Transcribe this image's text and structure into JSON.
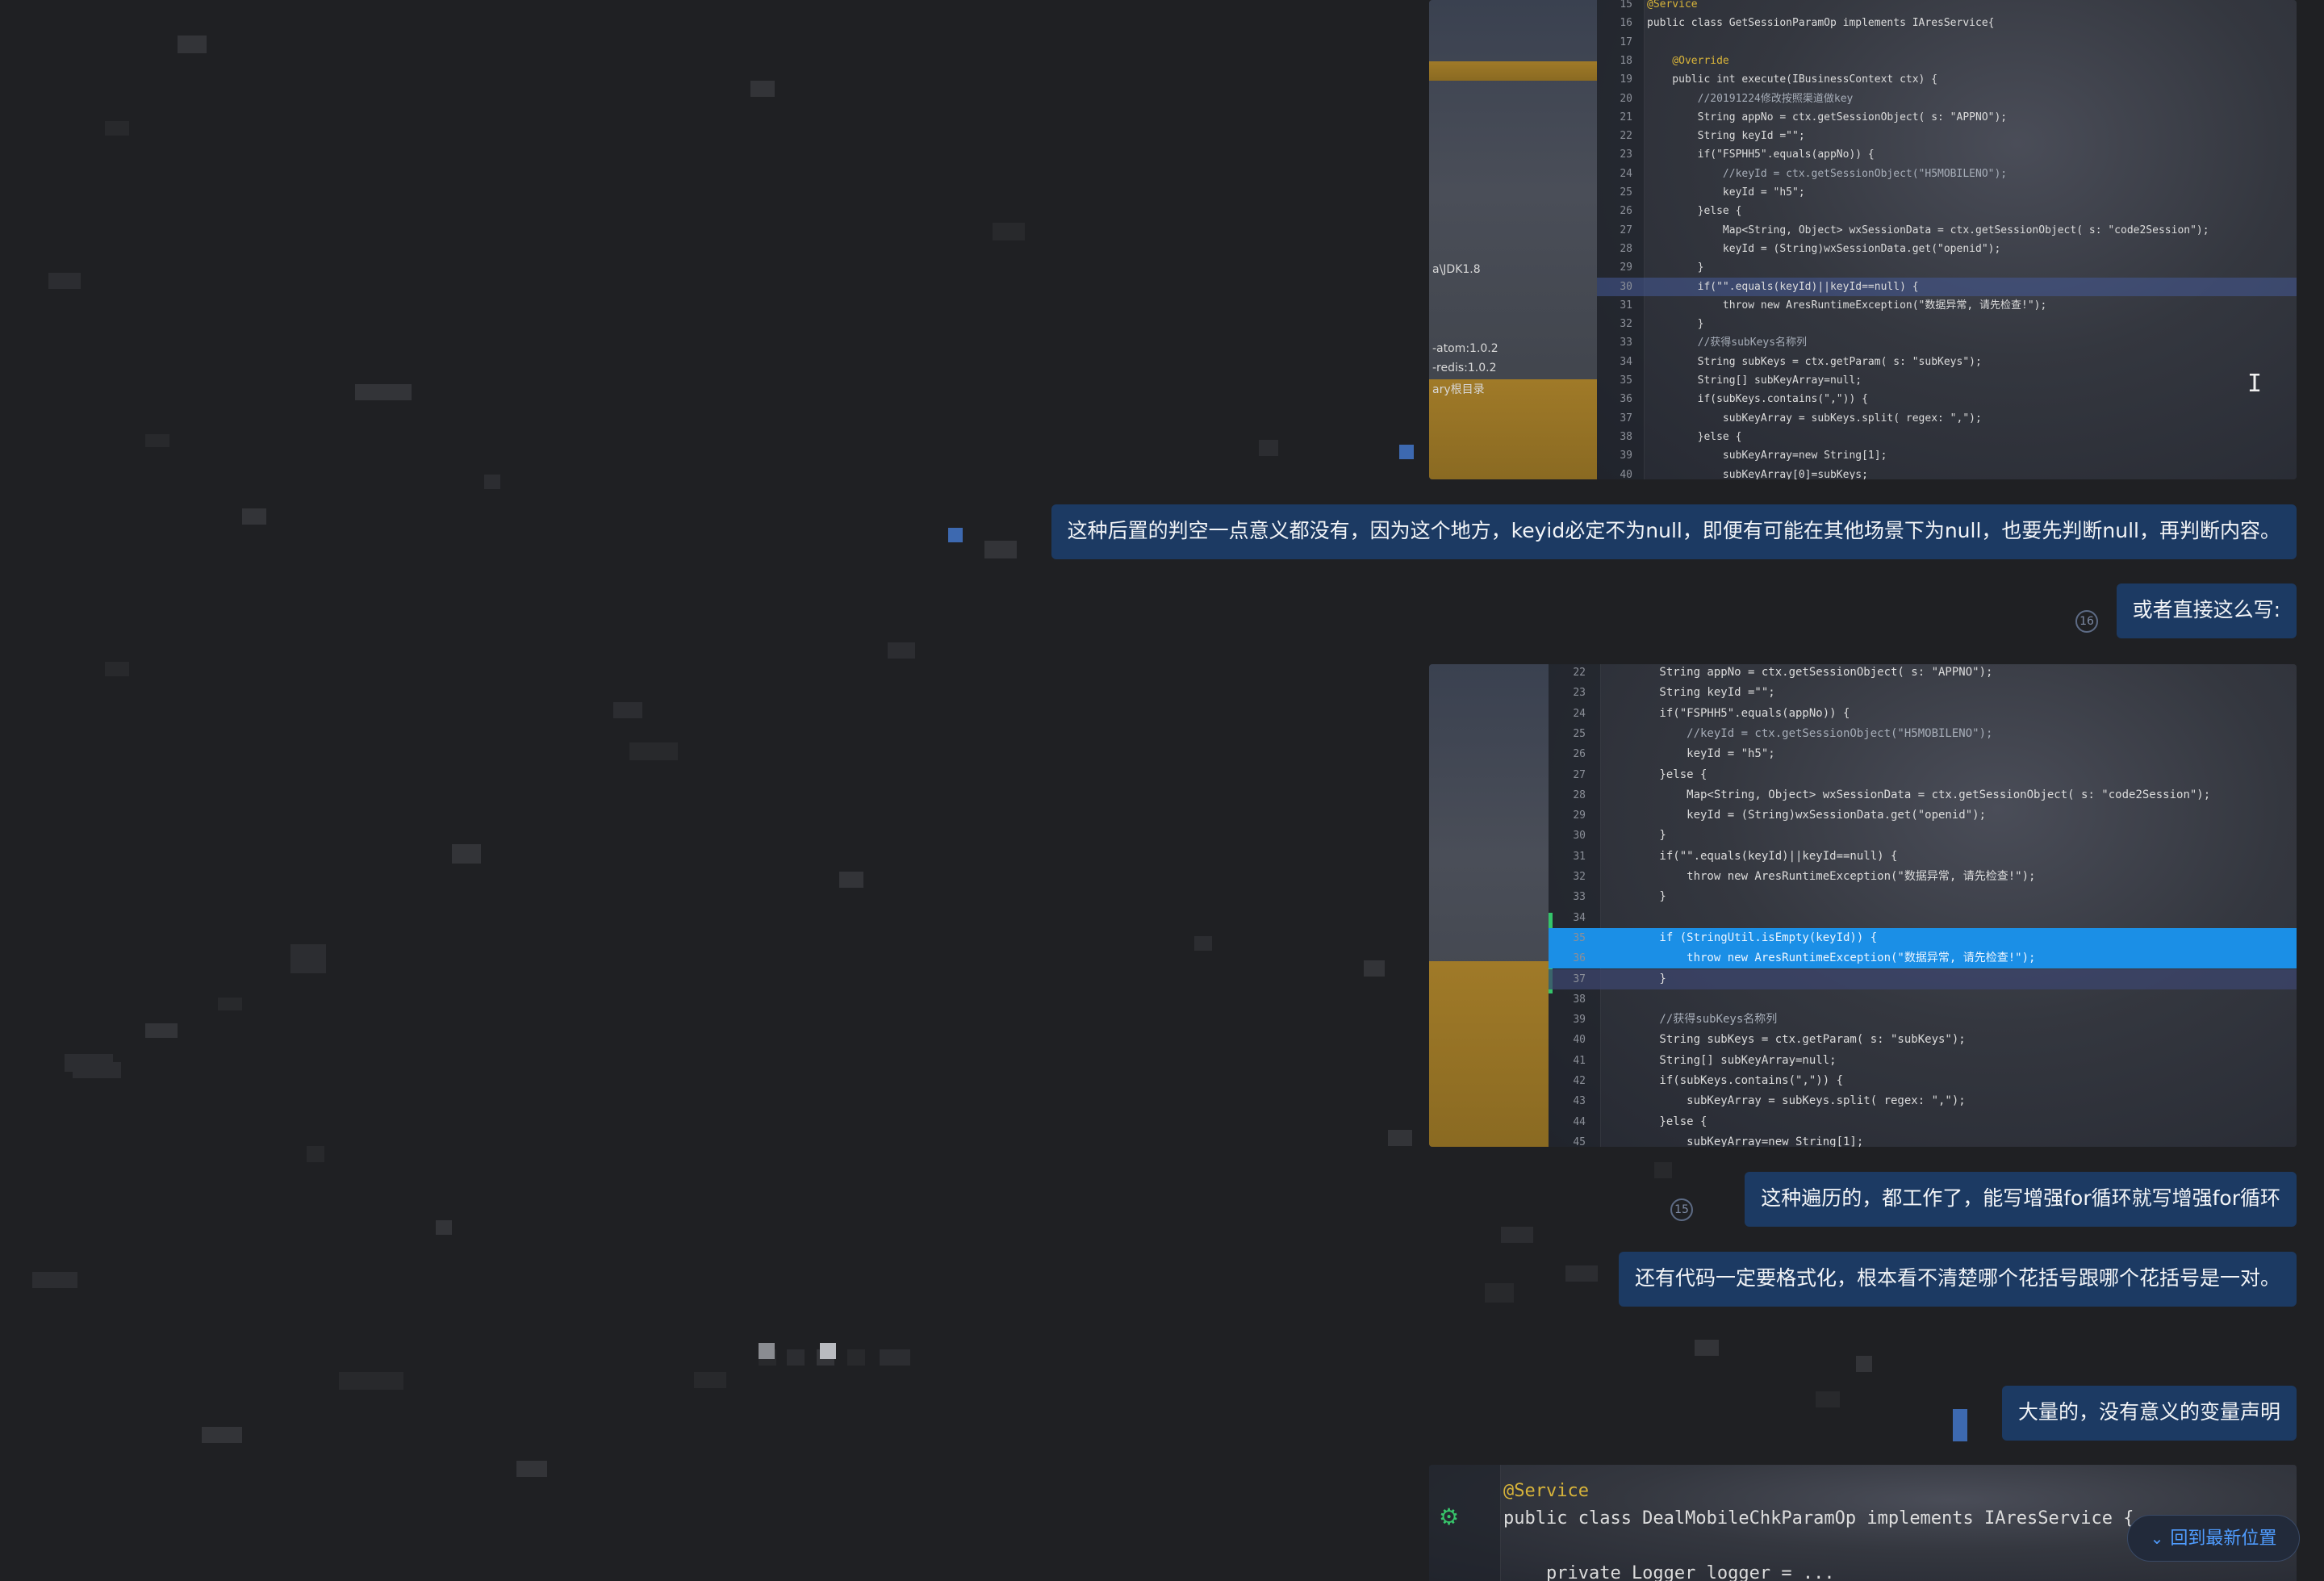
{
  "screenshot_1": {
    "libs": [
      "a\\JDK1.8",
      "-atom:1.0.2",
      "-redis:1.0.2",
      "ary根目录"
    ],
    "lines": [
      {
        "n": "15",
        "text": "@Service",
        "style": "anno"
      },
      {
        "n": "16",
        "text": "public class GetSessionParamOp implements IAresService{",
        "style": ""
      },
      {
        "n": "17",
        "text": "",
        "style": ""
      },
      {
        "n": "18",
        "text": "    @Override",
        "style": "anno"
      },
      {
        "n": "19",
        "text": "    public int execute(IBusinessContext ctx) {",
        "style": ""
      },
      {
        "n": "20",
        "text": "        //20191224修改按照渠道做key",
        "style": "cmt"
      },
      {
        "n": "21",
        "text": "        String appNo = ctx.getSessionObject( s: \"APPNO\");",
        "style": ""
      },
      {
        "n": "22",
        "text": "        String keyId =\"\";",
        "style": ""
      },
      {
        "n": "23",
        "text": "        if(\"FSPHH5\".equals(appNo)) {",
        "style": ""
      },
      {
        "n": "24",
        "text": "            //keyId = ctx.getSessionObject(\"H5MOBILENO\");",
        "style": "cmt"
      },
      {
        "n": "25",
        "text": "            keyId = \"h5\";",
        "style": ""
      },
      {
        "n": "26",
        "text": "        }else {",
        "style": ""
      },
      {
        "n": "27",
        "text": "            Map<String, Object> wxSessionData = ctx.getSessionObject( s: \"code2Session\");",
        "style": ""
      },
      {
        "n": "28",
        "text": "            keyId = (String)wxSessionData.get(\"openid\");",
        "style": ""
      },
      {
        "n": "29",
        "text": "        }",
        "style": ""
      },
      {
        "n": "30",
        "text": "        if(\"\".equals(keyId)||keyId==null) {",
        "style": "hl-dim"
      },
      {
        "n": "31",
        "text": "            throw new AresRuntimeException(\"数据异常, 请先检查!\");",
        "style": ""
      },
      {
        "n": "32",
        "text": "        }",
        "style": ""
      },
      {
        "n": "33",
        "text": "        //获得subKeys名称列",
        "style": "cmt"
      },
      {
        "n": "34",
        "text": "        String subKeys = ctx.getParam( s: \"subKeys\");",
        "style": ""
      },
      {
        "n": "35",
        "text": "        String[] subKeyArray=null;",
        "style": ""
      },
      {
        "n": "36",
        "text": "        if(subKeys.contains(\",\")) {",
        "style": ""
      },
      {
        "n": "37",
        "text": "            subKeyArray = subKeys.split( regex: \",\");",
        "style": ""
      },
      {
        "n": "38",
        "text": "        }else {",
        "style": ""
      },
      {
        "n": "39",
        "text": "            subKeyArray=new String[1];",
        "style": ""
      },
      {
        "n": "40",
        "text": "            subKeyArray[0]=subKeys;",
        "style": ""
      }
    ]
  },
  "messages": [
    {
      "text": "这种后置的判空一点意义都没有，因为这个地方，keyid必定不为null，即便有可能在其他场景下为null，也要先判断null，再判断内容。"
    },
    {
      "text": "或者直接这么写:",
      "read_count": "16"
    },
    {
      "text": "这种遍历的，都工作了，能写增强for循环就写增强for循环",
      "read_count": "15"
    },
    {
      "text": "还有代码一定要格式化，根本看不清楚哪个花括号跟哪个花括号是一对。"
    },
    {
      "text": "大量的，没有意义的变量声明"
    }
  ],
  "screenshot_2": {
    "lines": [
      {
        "n": "22",
        "text": "        String appNo = ctx.getSessionObject( s: \"APPNO\");",
        "style": ""
      },
      {
        "n": "23",
        "text": "        String keyId =\"\";",
        "style": ""
      },
      {
        "n": "24",
        "text": "        if(\"FSPHH5\".equals(appNo)) {",
        "style": ""
      },
      {
        "n": "25",
        "text": "            //keyId = ctx.getSessionObject(\"H5MOBILENO\");",
        "style": "cmt"
      },
      {
        "n": "26",
        "text": "            keyId = \"h5\";",
        "style": ""
      },
      {
        "n": "27",
        "text": "        }else {",
        "style": ""
      },
      {
        "n": "28",
        "text": "            Map<String, Object> wxSessionData = ctx.getSessionObject( s: \"code2Session\");",
        "style": ""
      },
      {
        "n": "29",
        "text": "            keyId = (String)wxSessionData.get(\"openid\");",
        "style": ""
      },
      {
        "n": "30",
        "text": "        }",
        "style": ""
      },
      {
        "n": "31",
        "text": "        if(\"\".equals(keyId)||keyId==null) {",
        "style": ""
      },
      {
        "n": "32",
        "text": "            throw new AresRuntimeException(\"数据异常, 请先检查!\");",
        "style": ""
      },
      {
        "n": "33",
        "text": "        }",
        "style": ""
      },
      {
        "n": "34",
        "text": "",
        "style": ""
      },
      {
        "n": "35",
        "text": "        if (StringUtil.isEmpty(keyId)) {",
        "style": "hl-blue"
      },
      {
        "n": "36",
        "text": "            throw new AresRuntimeException(\"数据异常, 请先检查!\");",
        "style": "hl-blue"
      },
      {
        "n": "37",
        "text": "        }",
        "style": "hl-cur"
      },
      {
        "n": "38",
        "text": "",
        "style": ""
      },
      {
        "n": "39",
        "text": "        //获得subKeys名称列",
        "style": "cmt"
      },
      {
        "n": "40",
        "text": "        String subKeys = ctx.getParam( s: \"subKeys\");",
        "style": ""
      },
      {
        "n": "41",
        "text": "        String[] subKeyArray=null;",
        "style": ""
      },
      {
        "n": "42",
        "text": "        if(subKeys.contains(\",\")) {",
        "style": ""
      },
      {
        "n": "43",
        "text": "            subKeyArray = subKeys.split( regex: \",\");",
        "style": ""
      },
      {
        "n": "44",
        "text": "        }else {",
        "style": ""
      },
      {
        "n": "45",
        "text": "            subKeyArray=new String[1];",
        "style": ""
      }
    ]
  },
  "screenshot_3": {
    "lines": [
      {
        "text": "@Service",
        "style": "anno"
      },
      {
        "text": "public class DealMobileChkParamOp implements IAresService {",
        "style": ""
      },
      {
        "text": "",
        "style": ""
      },
      {
        "text": "    private Logger logger = ...",
        "style": ""
      }
    ]
  },
  "back_to_latest": {
    "label": "回到最新位置",
    "icon": "double-chevron-down-icon"
  },
  "colors": {
    "background": "#1f2023",
    "bubble": "#1c3a63",
    "accent": "#4f9cff",
    "selection": "#1b8fe6"
  }
}
